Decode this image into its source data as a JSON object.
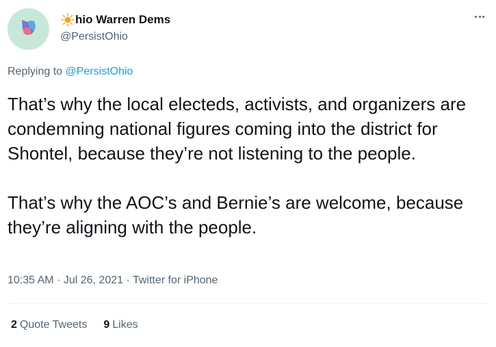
{
  "author": {
    "display_name": "hio Warren Dems",
    "handle": "@PersistOhio",
    "avatar_icon": "ohio-map-icon",
    "name_prefix_icon": "sun-icon"
  },
  "reply": {
    "prefix": "Replying to ",
    "target": "@PersistOhio"
  },
  "tweet": {
    "paragraphs": [
      "That’s why the local electeds, activists, and organizers are condemning national figures coming into the district for Shontel, because they’re not listening to the people.",
      "That’s why the AOC’s and Bernie’s are welcome, because they’re aligning with the people."
    ]
  },
  "meta": {
    "time": "10:35 AM",
    "separator": " · ",
    "date": "Jul 26, 2021",
    "source": "Twitter for iPhone"
  },
  "stats": {
    "quote_count": "2",
    "quote_label": "Quote Tweets",
    "likes_count": "9",
    "likes_label": "Likes"
  },
  "colors": {
    "link": "#1d9bf0",
    "secondary": "#536471",
    "avatar_bg": "#c7e8d9"
  }
}
